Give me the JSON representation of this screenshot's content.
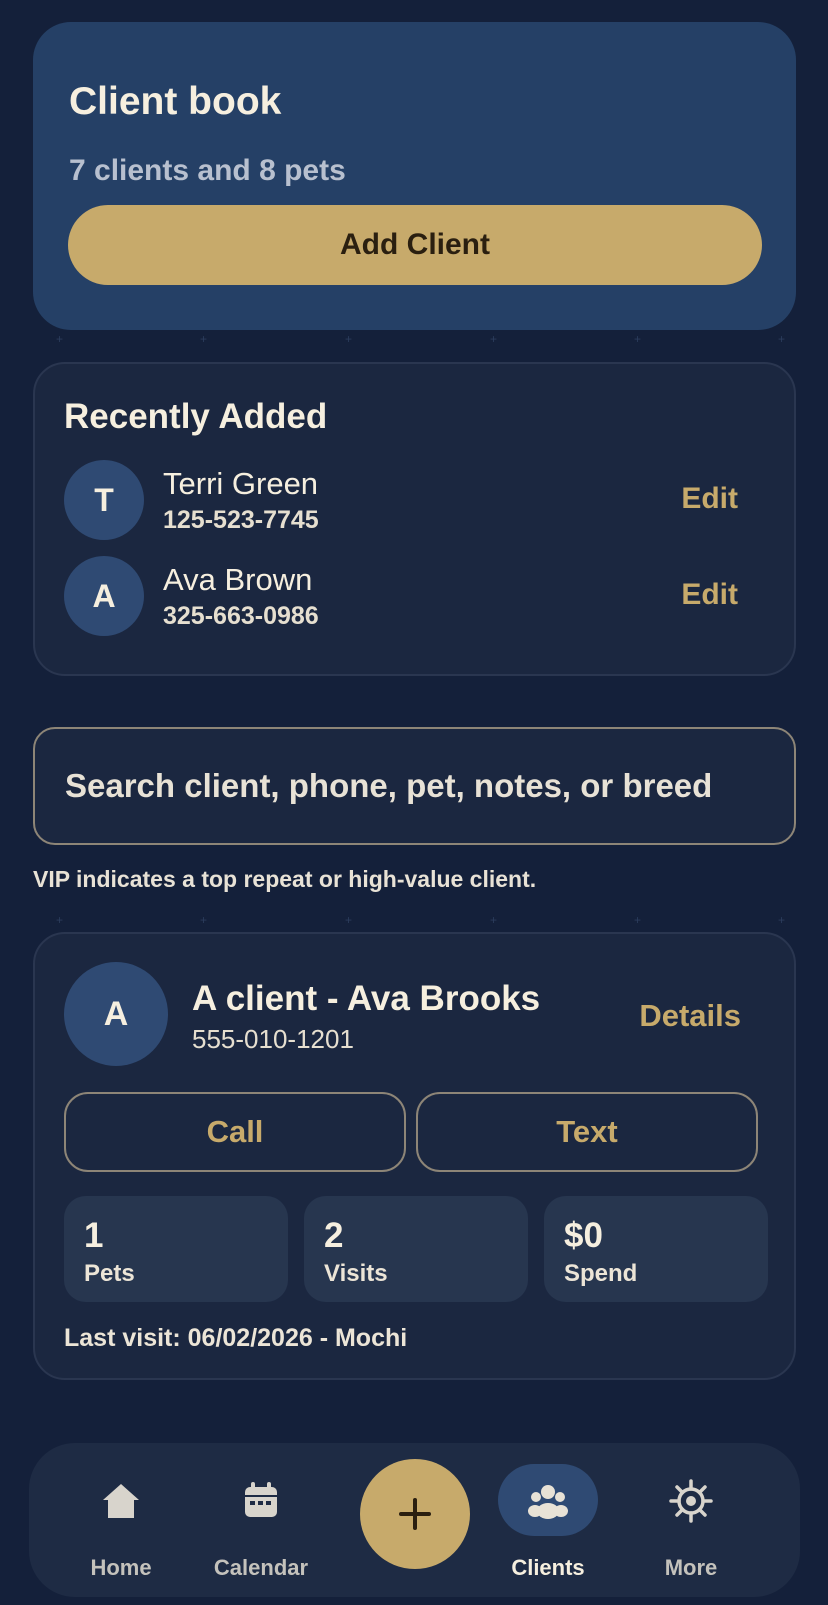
{
  "header": {
    "title": "Client book",
    "subtitle": "7 clients and 8 pets",
    "add_button_label": "Add Client"
  },
  "recent": {
    "title": "Recently Added",
    "items": [
      {
        "initial": "T",
        "name": "Terri Green",
        "phone": "125-523-7745",
        "action": "Edit"
      },
      {
        "initial": "A",
        "name": "Ava Brown",
        "phone": "325-663-0986",
        "action": "Edit"
      }
    ]
  },
  "search": {
    "placeholder": "Search client, phone, pet, notes, or breed",
    "value": ""
  },
  "vip_note": "VIP indicates a top repeat or high-value client.",
  "client_card": {
    "initial": "A",
    "name": "A client - Ava Brooks",
    "phone": "555-010-1201",
    "details_label": "Details",
    "call_label": "Call",
    "text_label": "Text",
    "stats": [
      {
        "value": "1",
        "label": "Pets"
      },
      {
        "value": "2",
        "label": "Visits"
      },
      {
        "value": "$0",
        "label": "Spend"
      }
    ],
    "last_visit": "Last visit: 06/02/2026 - Mochi"
  },
  "nav": {
    "items": [
      {
        "label": "Home",
        "icon": "home-icon"
      },
      {
        "label": "Calendar",
        "icon": "calendar-icon"
      },
      {
        "label": "",
        "icon": "plus-icon"
      },
      {
        "label": "Clients",
        "icon": "clients-icon",
        "active": true
      },
      {
        "label": "More",
        "icon": "gear-icon"
      }
    ]
  },
  "colors": {
    "background": "#14203a",
    "header_card": "#254066",
    "card": "#1b2740",
    "accent": "#c7aa6b",
    "avatar": "#2f4a73",
    "text": "#f6efdf"
  }
}
